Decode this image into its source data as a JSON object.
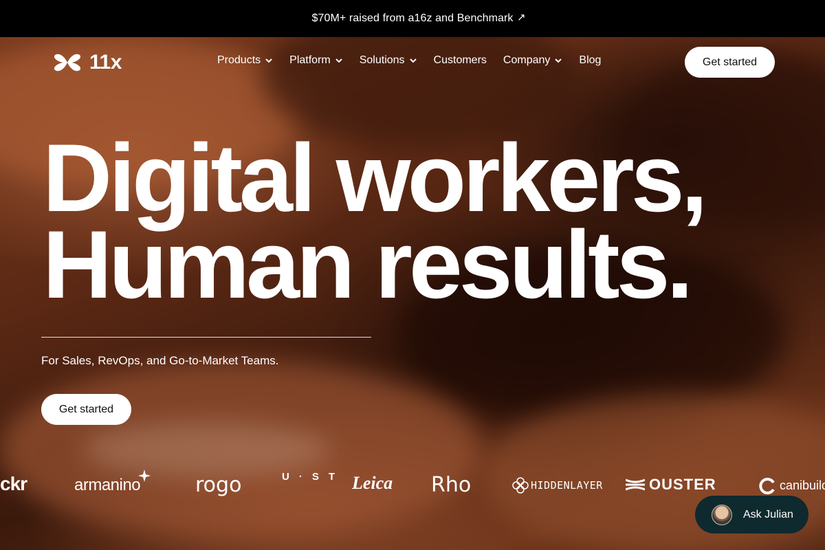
{
  "announcement": {
    "text": "$70M+ raised from a16z and Benchmark",
    "arrow": "↗"
  },
  "header": {
    "logo_text": "11x",
    "nav": [
      {
        "label": "Products",
        "has_dropdown": true
      },
      {
        "label": "Platform",
        "has_dropdown": true
      },
      {
        "label": "Solutions",
        "has_dropdown": true
      },
      {
        "label": "Customers",
        "has_dropdown": false
      },
      {
        "label": "Company",
        "has_dropdown": true
      },
      {
        "label": "Blog",
        "has_dropdown": false
      }
    ],
    "cta_label": "Get started"
  },
  "hero": {
    "headline_line1": "Digital workers,",
    "headline_line2": "Human results.",
    "subheadline": "For Sales, RevOps, and Go-to-Market Teams.",
    "cta_label": "Get started"
  },
  "logos": [
    "ckr",
    "armanino",
    "rogo",
    "U·ST",
    "Leica",
    "Rho",
    "HIDDENLAYER",
    "OUSTER",
    "canibuild"
  ],
  "chat": {
    "label": "Ask Julian"
  },
  "colors": {
    "announcement_bg": "#000000",
    "chat_bg": "#0e2a2e",
    "button_bg": "#ffffff"
  }
}
